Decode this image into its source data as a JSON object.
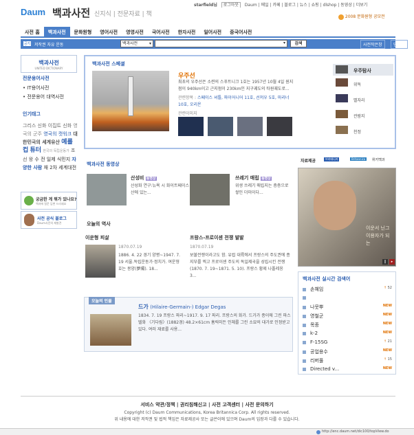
{
  "header": {
    "logo": "Daum",
    "title": "백과사전",
    "sub_links": [
      "신지식",
      "전문자료",
      "책"
    ],
    "user": "starfield님",
    "logout": "로그아웃",
    "util_links": [
      "Daum",
      "메일",
      "카페",
      "블로그",
      "뉴스",
      "쇼핑",
      "dlshop",
      "동영상",
      "더보기"
    ],
    "promo": "2008 문화원형 공모전"
  },
  "gnav": {
    "items": [
      "사전 홈",
      "백과사전",
      "문화원형",
      "영어사전",
      "영영사전",
      "국어사전",
      "한자사전",
      "일어사전",
      "중국어사전"
    ],
    "active": 1
  },
  "search": {
    "tag": "공지",
    "notice": "저작권 자유 운동",
    "select_value": "백과사전",
    "button": "검색",
    "right_buttons": [
      "사전작은창",
      "단어장"
    ]
  },
  "left": {
    "brand_title": "백과사전",
    "brand_sub": "UNITED DICTIONARY",
    "links_title": "전문용어사전",
    "links": [
      "IT용어사전",
      "전문용어 대역사전"
    ],
    "tags_title": "인기태그",
    "tags": [
      "그리스 신화",
      "이집트 신화",
      "영국의 군주",
      "영국의",
      "캣워크",
      "대한민국의 세계유산",
      "예를",
      "컵",
      "튜터",
      "한국의 독립운동가",
      "조선",
      "왕",
      "수",
      "전",
      "일제 식민지",
      "자양한 사람",
      "재",
      "2차 세계대전"
    ],
    "banner1_title": "궁금한 게 뭐가 있나요?",
    "banner1_sub": "백과에 질문 답변 드리세요",
    "banner2_title": "사전 공식 블로그",
    "banner2_sub": "Daum사전의 재발견"
  },
  "special": {
    "label": "백과사전 스페셜",
    "title": "우주선",
    "desc": "최초의 우주선은 소련의 스푸트니크 1호는 1957년 10월 4일 원지점이 940km이고 근지점이 230km인 지구궤도의 타원궤도로...",
    "related_label": "관련항목 :",
    "related": "스페이스 셔틀, 파이어니어 11호, 선저우 5호, 마리너 10호, 오리온",
    "images_label": "관련이미지",
    "menu": [
      "우주탐사",
      "위독",
      "별자리",
      "관람지",
      "천정"
    ]
  },
  "video": {
    "label": "백과사전 동영상",
    "items": [
      {
        "title": "산성비",
        "badge": "동영상",
        "desc": "산성화 연구:뉴욕 시 화이트페이스 산에 있는..."
      },
      {
        "title": "쓰레기 매립",
        "badge": "동영상",
        "desc": "위생 쓰레기 매립지는 층층으로 쌓인 더미이다..."
      }
    ]
  },
  "history": {
    "label": "오늘의 역사",
    "items": [
      {
        "title": "이운형 피살",
        "date": "1870.07.19",
        "desc": "1886. 4. 22 경기 양평~1947. 7. 19 서울.독립운동가·정치가. 여운형 호는 몽양(夢陽). 18..."
      },
      {
        "title": "프랑스-프로이센 전쟁 발발",
        "date": "1870.07.19",
        "desc": "보불전쟁이라고도 함. 유럽 대륙에서 프랑스의 주도권에 종지부를 찍고 프로이센 주도의 독일제국을 성립시킨 전쟁(1870. 7. 19~1871. 5. 10). 프랑스 황제 나폴레옹 3..."
      }
    ]
  },
  "person": {
    "label": "오늘의 인물",
    "name": "드가",
    "name_en": "(Hilaire-Germain-) Edgar Degas",
    "desc": "1834. 7. 19 프랑스 파리~1917. 9. 17 파리. 프랑스의 화가. 드가가 종이에 그린 파스텔화 〈기다림〉(1882경) 48.2×61cm 홈릭미든 인체를 그린 소묘의 대가로 인정받고 있다. 여러 재료를 사용..."
  },
  "sponsor": {
    "label": "자료제공",
    "logos": [
      "브리태니커",
      "Britannica",
      "위키백과"
    ],
    "caption": "이운서 닌그 이용자가 되는"
  },
  "realtime": {
    "label": "백과사전 실시간 검색어",
    "items": [
      {
        "word": "손혜임",
        "change": "52",
        "dir": "up"
      },
      {
        "word": "",
        "change": "",
        "dir": ""
      },
      {
        "word": "나뭇뿌",
        "change": "NEW",
        "dir": "new"
      },
      {
        "word": "영철군",
        "change": "NEW",
        "dir": "new"
      },
      {
        "word": "목종",
        "change": "NEW",
        "dir": "new"
      },
      {
        "word": "k-2",
        "change": "NEW",
        "dir": "new"
      },
      {
        "word": "F-15SG",
        "change": "21",
        "dir": "up"
      },
      {
        "word": "공업용수",
        "change": "NEW",
        "dir": "new"
      },
      {
        "word": "리버풀",
        "change": "15",
        "dir": "up"
      },
      {
        "word": "Directed v...",
        "change": "NEW",
        "dir": "new"
      }
    ]
  },
  "footer": {
    "links": [
      "서비스 약관/정책",
      "권리침해신고",
      "사전 고객센터",
      "사전 문의하기"
    ],
    "copyright": "Copyright (c) Daum Communications, Korea Britannica Corp. All rights reserved.",
    "notice": "위 내용에 대한 저작권 및 법적 책임은 자료제공사 또는 글쓴이에 있으며 Daum의 입장과 다를 수 있습니다.",
    "status_url": "http://enc.daum.net/dic100/topView.do"
  },
  "colors": {
    "accent": "#4a7fc9",
    "link": "#2a5db0",
    "orange": "#e07000"
  }
}
